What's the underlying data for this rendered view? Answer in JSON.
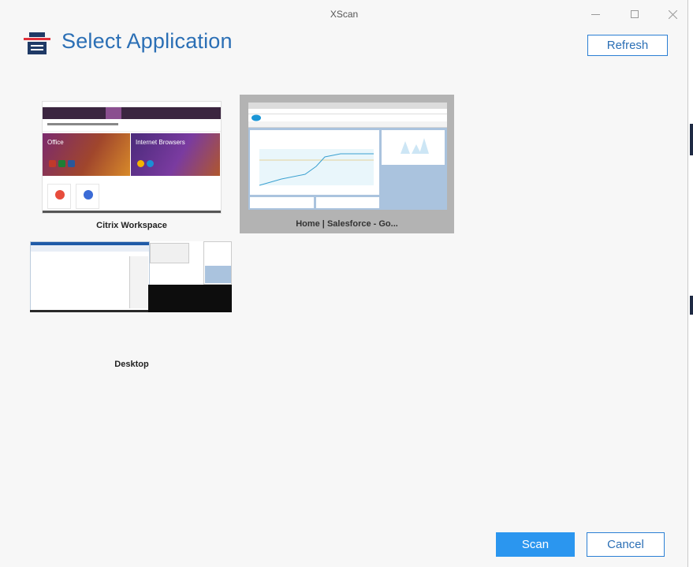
{
  "window": {
    "title": "XScan"
  },
  "header": {
    "title": "Select Application",
    "icon": "scan-document-icon",
    "refresh_label": "Refresh"
  },
  "applications": [
    {
      "label": "Citrix Workspace",
      "selected": false
    },
    {
      "label": "Home | Salesforce - Go...",
      "selected": true
    },
    {
      "label": "Desktop",
      "selected": false
    }
  ],
  "footer": {
    "scan_label": "Scan",
    "cancel_label": "Cancel"
  },
  "colors": {
    "accent": "#2b96ef",
    "heading": "#2b6fb5",
    "selected_tile": "#b3b3b3"
  }
}
